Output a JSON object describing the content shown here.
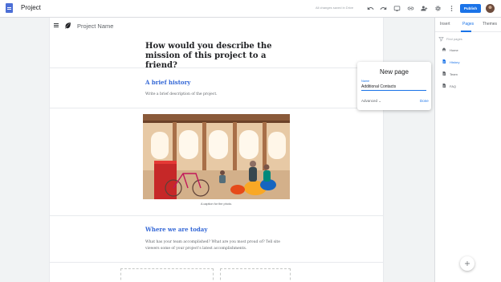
{
  "header": {
    "title": "Project",
    "save_status": "All changes saved in Drive",
    "publish_label": "Publish",
    "icons": [
      "undo-icon",
      "redo-icon",
      "preview-icon",
      "link-icon",
      "share-icon",
      "settings-icon",
      "more-vert-icon"
    ]
  },
  "site": {
    "project_name": "Project Name",
    "hero_title": "How would you describe the mission of this project to a friend?",
    "section1_title": "A brief history",
    "section1_body": "Write a brief description of the project.",
    "photo_caption": "A caption for the photo.",
    "section2_title": "Where we are today",
    "section2_body": "What has your team accomplished? What are you most proud of? Tell site viewers some of your project's latest accomplishments."
  },
  "panel": {
    "tabs": [
      "Insert",
      "Pages",
      "Themes"
    ],
    "active_tab": "Pages",
    "find_placeholder": "Find pages",
    "pages": [
      {
        "label": "Home",
        "icon": "home-icon",
        "active": false
      },
      {
        "label": "History",
        "icon": "page-icon",
        "active": true
      },
      {
        "label": "Team",
        "icon": "page-icon",
        "active": false
      },
      {
        "label": "FAQ",
        "icon": "page-icon",
        "active": false
      }
    ]
  },
  "dialog": {
    "title": "New page",
    "name_label": "Name",
    "name_value": "Additional Contacts",
    "advanced_label": "Advanced",
    "done_label": "Done"
  },
  "colors": {
    "accent": "#1a73e8",
    "heading_blue": "#3367d6"
  }
}
